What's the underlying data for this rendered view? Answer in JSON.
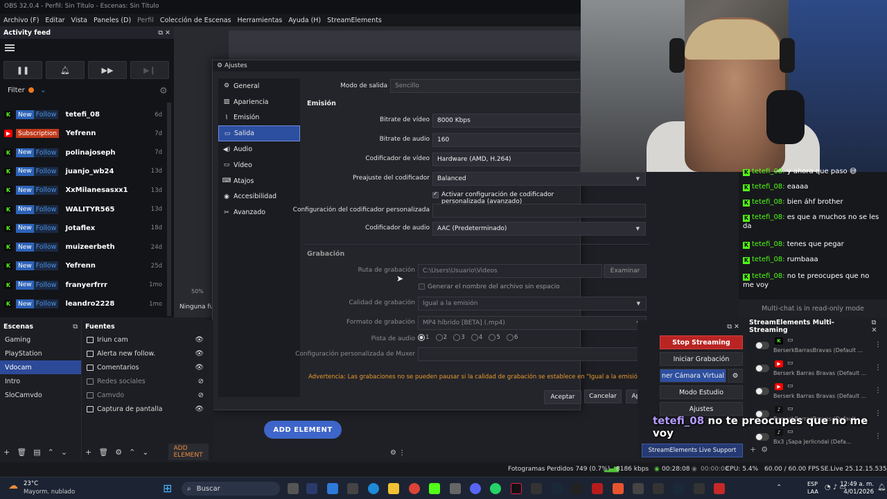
{
  "window_title": "OBS 32.0.4 - Perfil: Sin Título - Escenas: Sin Título",
  "menu": [
    "Archivo (F)",
    "Editar",
    "Vista",
    "Paneles (D)",
    "Perfil",
    "Colección de Escenas",
    "Herramientas",
    "Ayuda (H)",
    "StreamElements"
  ],
  "activity_feed": {
    "title": "Activity feed",
    "filter_label": "Filter",
    "events": [
      {
        "platform": "kick",
        "badge": "New",
        "type": "Follow",
        "name": "tetefi_08",
        "time": "6d"
      },
      {
        "platform": "youtube",
        "badge": "Subscription",
        "type": "",
        "name": "Yefrenn",
        "time": "7d"
      },
      {
        "platform": "kick",
        "badge": "New",
        "type": "Follow",
        "name": "polinajoseph",
        "time": "7d"
      },
      {
        "platform": "kick",
        "badge": "New",
        "type": "Follow",
        "name": "juanjo_wb24",
        "time": "13d"
      },
      {
        "platform": "kick",
        "badge": "New",
        "type": "Follow",
        "name": "XxMilanesasxx1",
        "time": "13d"
      },
      {
        "platform": "kick",
        "badge": "New",
        "type": "Follow",
        "name": "WALITYR565",
        "time": "13d"
      },
      {
        "platform": "kick",
        "badge": "New",
        "type": "Follow",
        "name": "Jotaflex",
        "time": "18d"
      },
      {
        "platform": "kick",
        "badge": "New",
        "type": "Follow",
        "name": "muizeerbeth",
        "time": "24d"
      },
      {
        "platform": "kick",
        "badge": "New",
        "type": "Follow",
        "name": "Yefrenn",
        "time": "25d"
      },
      {
        "platform": "kick",
        "badge": "New",
        "type": "Follow",
        "name": "franyerfrrr",
        "time": "1mo"
      },
      {
        "platform": "kick",
        "badge": "New",
        "type": "Follow",
        "name": "leandro2228",
        "time": "1mo"
      }
    ]
  },
  "scenes": {
    "title": "Escenas",
    "items": [
      "Gaming",
      "PlayStation",
      "Vdocam",
      "Intro",
      "SloCamvdo"
    ],
    "selected": "Vdocam"
  },
  "sources": {
    "title": "Fuentes",
    "items": [
      {
        "name": "Iriun cam",
        "visible": true
      },
      {
        "name": "Alerta new follow.",
        "visible": true
      },
      {
        "name": "Comentarios",
        "visible": true
      },
      {
        "name": "Redes sociales",
        "visible": false
      },
      {
        "name": "Camvdo",
        "visible": false
      },
      {
        "name": "Captura de pantalla",
        "visible": true
      }
    ],
    "add_element_label": "ADD ELEMENT"
  },
  "preview": {
    "zoom": "50%",
    "no_source": "Ninguna fu",
    "add_element_button": "ADD ELEMENT"
  },
  "settings": {
    "title": "Ajustes",
    "nav": [
      "General",
      "Apariencia",
      "Emisión",
      "Salida",
      "Audio",
      "Vídeo",
      "Atajos",
      "Accesibilidad",
      "Avanzado"
    ],
    "selected_nav": "Salida",
    "output_mode_label": "Modo de salida",
    "output_mode_value": "Sencillo",
    "streaming": {
      "title": "Emisión",
      "video_bitrate_label": "Bitrate de vídeo",
      "video_bitrate_value": "8000 Kbps",
      "audio_bitrate_label": "Bitrate de audio",
      "audio_bitrate_value": "160",
      "video_encoder_label": "Codificador de vídeo",
      "video_encoder_value": "Hardware (AMD, H.264)",
      "preset_label": "Preajuste del codificador",
      "preset_value": "Balanced",
      "custom_enc_checkbox": "Activar configuración de codificador personalizada (avanzado)",
      "custom_enc_label": "Configuración del codificador personalizada",
      "audio_encoder_label": "Codificador de audio",
      "audio_encoder_value": "AAC (Predeterminado)"
    },
    "recording": {
      "title": "Grabación",
      "path_label": "Ruta de grabación",
      "path_value": "C:\\Users\\Usuario\\Videos",
      "browse_button": "Examinar",
      "no_space_checkbox": "Generar el nombre del archivo sin espacio",
      "quality_label": "Calidad de grabación",
      "quality_value": "Igual a la emisión",
      "format_label": "Formato de grabación",
      "format_value": "MP4 híbrido [BETA] (.mp4)",
      "audio_track_label": "Pista de audio",
      "audio_tracks": [
        "1",
        "2",
        "3",
        "4",
        "5",
        "6"
      ],
      "muxer_label": "Configuración personalizada de Muxer"
    },
    "warning": "Advertencia: Las grabaciones no se pueden pausar si la calidad de grabación se establece en \"Igual a la emisión\".",
    "buttons": {
      "ok": "Aceptar",
      "cancel": "Cancelar",
      "apply": "Aplicar"
    }
  },
  "chat": {
    "messages": [
      {
        "user": "tetefi_08:",
        "text": "y ahora que paso 😅"
      },
      {
        "user": "tetefi_08:",
        "text": "eaaaa"
      },
      {
        "user": "tetefi_08:",
        "text": "bien áhf brother"
      },
      {
        "user": "tetefi_08:",
        "text": "es que a muchos no se les da"
      },
      {
        "user": "tetefi_08:",
        "text": "tenes que pegar"
      },
      {
        "user": "tetefi_08:",
        "text": "rumbaaa"
      },
      {
        "user": "tetefi_08:",
        "text": "no te preocupes que no me voy"
      }
    ],
    "footer": "Multi-chat is in read-only mode"
  },
  "controls": {
    "stop_streaming": "Stop Streaming",
    "start_recording": "Iniciar Grabación",
    "virtual_cam": "ner Cámara Virtual",
    "studio_mode": "Modo Estudio",
    "settings": "Ajustes",
    "support": "StreamElements Live Support"
  },
  "multistream": {
    "title": "StreamElements Multi-Streaming",
    "rows": [
      {
        "platform": "kick",
        "name": "BerserkBarrasBravas (Default ..."
      },
      {
        "platform": "youtube",
        "name": "Berserk Barras Bravas (Default ..."
      },
      {
        "platform": "youtube",
        "name": "Berserk Barras Bravas (Default ..."
      },
      {
        "platform": "tiktok",
        "name": "BerserkBarrasBravas (Default ..."
      },
      {
        "platform": "tiktok",
        "name": "Bx3 ¡Sapa Jerlicndal (Defa..."
      }
    ]
  },
  "overlay_caption": {
    "user": "tetefi_08",
    "text": "no te preocupes que no me voy"
  },
  "statusbar": {
    "dropped_frames": "Fotogramas Perdidos 749 (0.7%)",
    "bitrate": "8186 kbps",
    "stream_time": "00:28:08",
    "rec_time": "00:00:00",
    "cpu": "CPU: 5.4%",
    "fps": "60.00 / 60.00 FPS",
    "version": "SE.Live 25.12.15.535"
  },
  "taskbar": {
    "weather_temp": "23°C",
    "weather_desc": "Mayorm. nublado",
    "search": "Buscar",
    "lang": "ESP",
    "lang2": "LAA",
    "time": "12:49 a. m.",
    "date": "4/01/2026"
  },
  "colors": {
    "accent": "#2d4fa0",
    "kick": "#53fc18",
    "youtube": "#ff0000",
    "warning": "#e89a2c",
    "stop": "#b92523"
  }
}
